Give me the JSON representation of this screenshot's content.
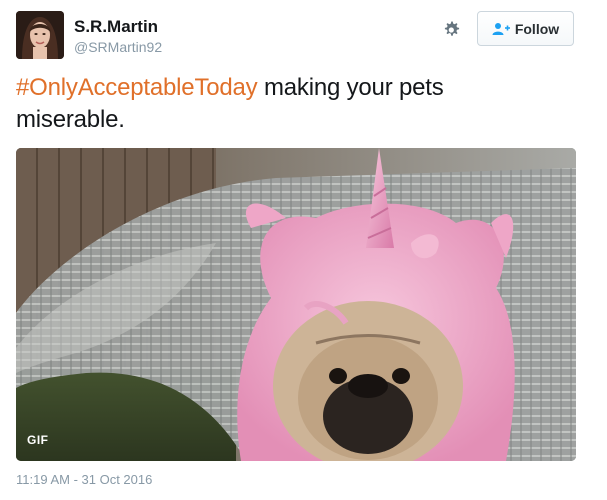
{
  "tweet": {
    "author": {
      "display_name": "S.R.Martin",
      "handle": "@SRMartin92"
    },
    "follow_label": "Follow",
    "text": {
      "hashtag": "#OnlyAcceptableToday",
      "rest_line1": " making your pets",
      "rest_line2": "miserable."
    },
    "media": {
      "badge": "GIF",
      "icon": "gif-media"
    },
    "timestamp": "11:19 AM - 31 Oct 2016"
  },
  "colors": {
    "hashtag": "#e0702a",
    "follow_icon": "#1da1f2",
    "muted": "#8899a6"
  }
}
